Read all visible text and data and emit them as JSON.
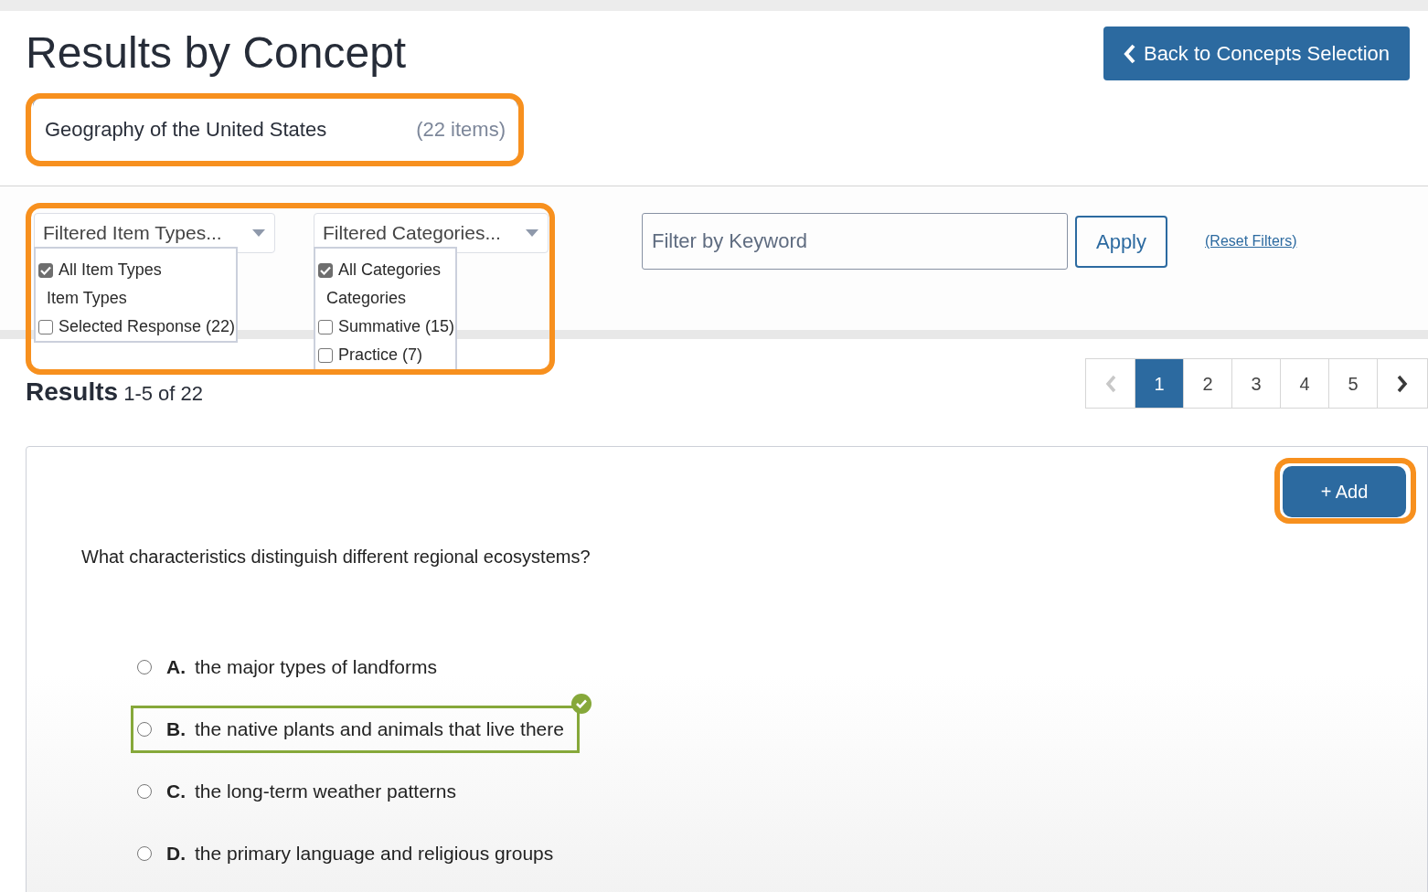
{
  "title": "Results by Concept",
  "back_button": {
    "label": "Back to Concepts Selection"
  },
  "concept": {
    "name": "Geography of the United States",
    "count": "(22 items)",
    "highlighted": true
  },
  "filters": {
    "highlighted": true,
    "dropdowns": [
      {
        "label": "Filtered Item Types...",
        "options": [
          {
            "kind": "check",
            "label": "All Item Types",
            "checked": true
          },
          {
            "kind": "header",
            "label": "Item Types"
          },
          {
            "kind": "check",
            "label": "Selected Response (22)",
            "checked": false
          }
        ]
      },
      {
        "label": "Filtered Categories...",
        "options": [
          {
            "kind": "check",
            "label": "All Categories",
            "checked": true
          },
          {
            "kind": "header",
            "label": "Categories"
          },
          {
            "kind": "check",
            "label": "Summative (15)",
            "checked": false
          },
          {
            "kind": "check",
            "label": "Practice (7)",
            "checked": false
          }
        ]
      }
    ]
  },
  "keyword": {
    "placeholder": "Filter by Keyword"
  },
  "apply_button": "Apply",
  "reset_link": "(Reset Filters)",
  "results": {
    "label": "Results",
    "range": "1-5 of 22"
  },
  "pagination": {
    "prev_disabled": true,
    "next_disabled": false,
    "pages": [
      {
        "label": "1",
        "selected": true
      },
      {
        "label": "2",
        "selected": false
      },
      {
        "label": "3",
        "selected": false
      },
      {
        "label": "4",
        "selected": false
      },
      {
        "label": "5",
        "selected": false
      }
    ]
  },
  "question": {
    "add_button": {
      "label": "+ Add",
      "highlighted": true
    },
    "text": "What characteristics distinguish different regional ecosystems?",
    "options": [
      {
        "letter": "A.",
        "text": "the major types of landforms",
        "checked": false,
        "correct": false
      },
      {
        "letter": "B.",
        "text": "the native plants and animals that live there",
        "checked": false,
        "correct": true
      },
      {
        "letter": "C.",
        "text": "the long-term weather patterns",
        "checked": false,
        "correct": false
      },
      {
        "letter": "D.",
        "text": "the primary language and religious groups",
        "checked": false,
        "correct": false
      }
    ]
  }
}
